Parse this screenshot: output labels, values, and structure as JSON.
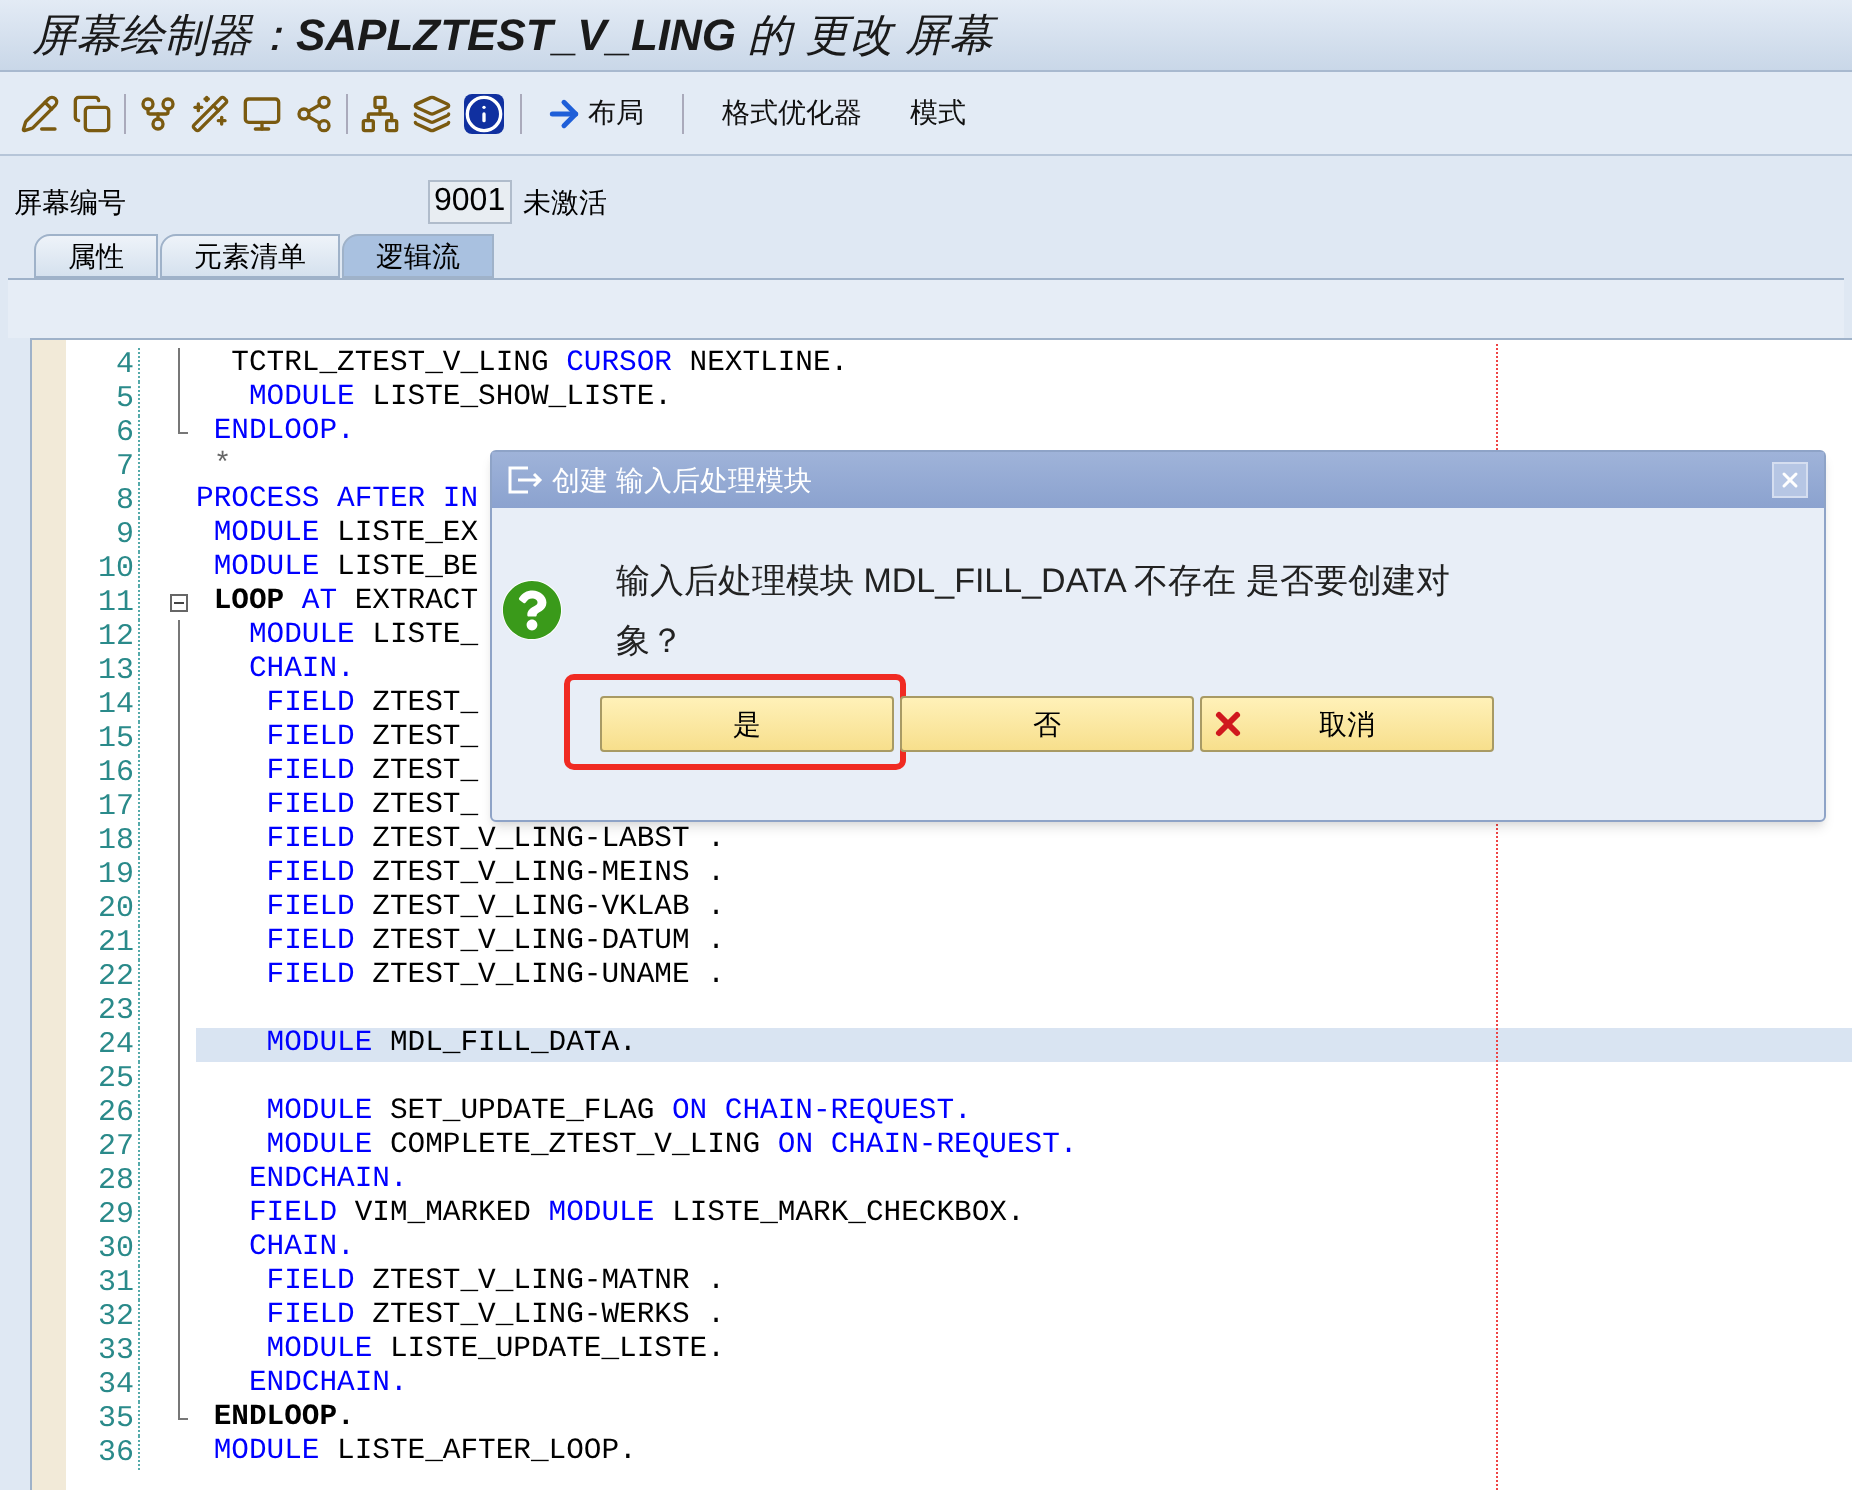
{
  "title": "屏幕绘制器：**SAPLZTEST_V_LING** 的 更改 屏幕",
  "toolbar": {
    "buttons": [
      {
        "label": "布局",
        "kind": "arrow"
      },
      {
        "label": "格式优化器",
        "kind": "text"
      },
      {
        "label": "模式",
        "kind": "text"
      }
    ]
  },
  "screen_number": {
    "label": "屏幕编号",
    "value": "9001",
    "status": "未激活"
  },
  "tabs": [
    {
      "label": "属性",
      "selected": false
    },
    {
      "label": "元素清单",
      "selected": false
    },
    {
      "label": "逻辑流",
      "selected": true
    }
  ],
  "editor": {
    "lines": [
      {
        "number": "4",
        "kind": "mid",
        "selected": false,
        "segments": [
          {
            "kind": "plain",
            "text": "  TCTRL_ZTEST_V_LING"
          },
          {
            "kind": "keyword",
            "text": " CURSOR"
          },
          {
            "kind": "plain",
            "text": " NEXTLINE."
          }
        ]
      },
      {
        "number": "5",
        "kind": "mid",
        "selected": false,
        "segments": [
          {
            "kind": "keyword",
            "text": "   MODULE"
          },
          {
            "kind": "plain",
            "text": " LISTE_SHOW_LISTE."
          }
        ]
      },
      {
        "number": "6",
        "kind": "end",
        "selected": false,
        "segments": [
          {
            "kind": "keyword",
            "text": " ENDLOOP."
          }
        ]
      },
      {
        "number": "7",
        "kind": "plain",
        "selected": false,
        "segments": [
          {
            "kind": "comment",
            "text": " *"
          }
        ]
      },
      {
        "number": "8",
        "kind": "plain",
        "selected": false,
        "segments": [
          {
            "kind": "keyword",
            "text": "PROCESS AFTER IN"
          }
        ]
      },
      {
        "number": "9",
        "kind": "plain",
        "selected": false,
        "segments": [
          {
            "kind": "keyword",
            "text": " MODULE"
          },
          {
            "kind": "plain",
            "text": " LISTE_EX"
          }
        ]
      },
      {
        "number": "10",
        "kind": "plain",
        "selected": false,
        "segments": [
          {
            "kind": "keyword",
            "text": " MODULE"
          },
          {
            "kind": "plain",
            "text": " LISTE_BE"
          }
        ]
      },
      {
        "number": "11",
        "kind": "start",
        "selected": false,
        "segments": [
          {
            "kind": "bold",
            "text": " LOOP"
          },
          {
            "kind": "keyword",
            "text": " AT"
          },
          {
            "kind": "plain",
            "text": " EXTRACT"
          }
        ]
      },
      {
        "number": "12",
        "kind": "mid",
        "selected": false,
        "segments": [
          {
            "kind": "keyword",
            "text": "   MODULE"
          },
          {
            "kind": "plain",
            "text": " LISTE_"
          }
        ]
      },
      {
        "number": "13",
        "kind": "mid",
        "selected": false,
        "segments": [
          {
            "kind": "keyword",
            "text": "   CHAIN."
          }
        ]
      },
      {
        "number": "14",
        "kind": "mid",
        "selected": false,
        "segments": [
          {
            "kind": "keyword",
            "text": "    FIELD"
          },
          {
            "kind": "plain",
            "text": " ZTEST_"
          }
        ]
      },
      {
        "number": "15",
        "kind": "mid",
        "selected": false,
        "segments": [
          {
            "kind": "keyword",
            "text": "    FIELD"
          },
          {
            "kind": "plain",
            "text": " ZTEST_"
          }
        ]
      },
      {
        "number": "16",
        "kind": "mid",
        "selected": false,
        "segments": [
          {
            "kind": "keyword",
            "text": "    FIELD"
          },
          {
            "kind": "plain",
            "text": " ZTEST_"
          }
        ]
      },
      {
        "number": "17",
        "kind": "mid",
        "selected": false,
        "segments": [
          {
            "kind": "keyword",
            "text": "    FIELD"
          },
          {
            "kind": "plain",
            "text": " ZTEST_"
          }
        ]
      },
      {
        "number": "18",
        "kind": "mid",
        "selected": false,
        "segments": [
          {
            "kind": "keyword",
            "text": "    FIELD"
          },
          {
            "kind": "plain",
            "text": " ZTEST_V_LING-LABST ."
          }
        ]
      },
      {
        "number": "19",
        "kind": "mid",
        "selected": false,
        "segments": [
          {
            "kind": "keyword",
            "text": "    FIELD"
          },
          {
            "kind": "plain",
            "text": " ZTEST_V_LING-MEINS ."
          }
        ]
      },
      {
        "number": "20",
        "kind": "mid",
        "selected": false,
        "segments": [
          {
            "kind": "keyword",
            "text": "    FIELD"
          },
          {
            "kind": "plain",
            "text": " ZTEST_V_LING-VKLAB ."
          }
        ]
      },
      {
        "number": "21",
        "kind": "mid",
        "selected": false,
        "segments": [
          {
            "kind": "keyword",
            "text": "    FIELD"
          },
          {
            "kind": "plain",
            "text": " ZTEST_V_LING-DATUM ."
          }
        ]
      },
      {
        "number": "22",
        "kind": "mid",
        "selected": false,
        "segments": [
          {
            "kind": "keyword",
            "text": "    FIELD"
          },
          {
            "kind": "plain",
            "text": " ZTEST_V_LING-UNAME ."
          }
        ]
      },
      {
        "number": "23",
        "kind": "mid",
        "selected": false
      },
      {
        "number": "24",
        "kind": "mid",
        "selected": true,
        "segments": [
          {
            "kind": "keyword",
            "text": "    MODULE"
          },
          {
            "kind": "plain",
            "text": " MDL_FILL_DATA."
          }
        ]
      },
      {
        "number": "25",
        "kind": "mid",
        "selected": false
      },
      {
        "number": "26",
        "kind": "mid",
        "selected": false,
        "segments": [
          {
            "kind": "keyword",
            "text": "    MODULE"
          },
          {
            "kind": "plain",
            "text": " SET_UPDATE_FLAG"
          },
          {
            "kind": "keyword",
            "text": " ON CHAIN-REQUEST."
          }
        ]
      },
      {
        "number": "27",
        "kind": "mid",
        "selected": false,
        "segments": [
          {
            "kind": "keyword",
            "text": "    MODULE"
          },
          {
            "kind": "plain",
            "text": " COMPLETE_ZTEST_V_LING"
          },
          {
            "kind": "keyword",
            "text": " ON CHAIN-REQUEST."
          }
        ]
      },
      {
        "number": "28",
        "kind": "mid",
        "selected": false,
        "segments": [
          {
            "kind": "keyword",
            "text": "   ENDCHAIN."
          }
        ]
      },
      {
        "number": "29",
        "kind": "mid",
        "selected": false,
        "segments": [
          {
            "kind": "keyword",
            "text": "   FIELD"
          },
          {
            "kind": "plain",
            "text": " VIM_MARKED"
          },
          {
            "kind": "keyword",
            "text": " MODULE"
          },
          {
            "kind": "plain",
            "text": " LISTE_MARK_CHECKBOX."
          }
        ]
      },
      {
        "number": "30",
        "kind": "mid",
        "selected": false,
        "segments": [
          {
            "kind": "keyword",
            "text": "   CHAIN."
          }
        ]
      },
      {
        "number": "31",
        "kind": "mid",
        "selected": false,
        "segments": [
          {
            "kind": "keyword",
            "text": "    FIELD"
          },
          {
            "kind": "plain",
            "text": " ZTEST_V_LING-MATNR ."
          }
        ]
      },
      {
        "number": "32",
        "kind": "mid",
        "selected": false,
        "segments": [
          {
            "kind": "keyword",
            "text": "    FIELD"
          },
          {
            "kind": "plain",
            "text": " ZTEST_V_LING-WERKS ."
          }
        ]
      },
      {
        "number": "33",
        "kind": "mid",
        "selected": false,
        "segments": [
          {
            "kind": "keyword",
            "text": "    MODULE"
          },
          {
            "kind": "plain",
            "text": " LISTE_UPDATE_LISTE."
          }
        ]
      },
      {
        "number": "34",
        "kind": "mid",
        "selected": false,
        "segments": [
          {
            "kind": "keyword",
            "text": "   ENDCHAIN."
          }
        ]
      },
      {
        "number": "35",
        "kind": "end",
        "selected": false,
        "segments": [
          {
            "kind": "bold",
            "text": " ENDLOOP."
          }
        ]
      },
      {
        "number": "36",
        "kind": "plain",
        "selected": false,
        "segments": [
          {
            "kind": "keyword",
            "text": " MODULE"
          },
          {
            "kind": "plain",
            "text": " LISTE_AFTER_LOOP."
          }
        ]
      }
    ]
  },
  "dialog": {
    "title": "创建 输入后处理模块",
    "message": "输入后处理模块 MDL_FILL_DATA 不存在 是否要创建对象？",
    "buttons": [
      {
        "label": "是",
        "kind": "plain",
        "highlighted": true
      },
      {
        "label": "否",
        "kind": "plain",
        "highlighted": false
      },
      {
        "label": "取消",
        "kind": "cancel",
        "highlighted": false
      }
    ]
  }
}
